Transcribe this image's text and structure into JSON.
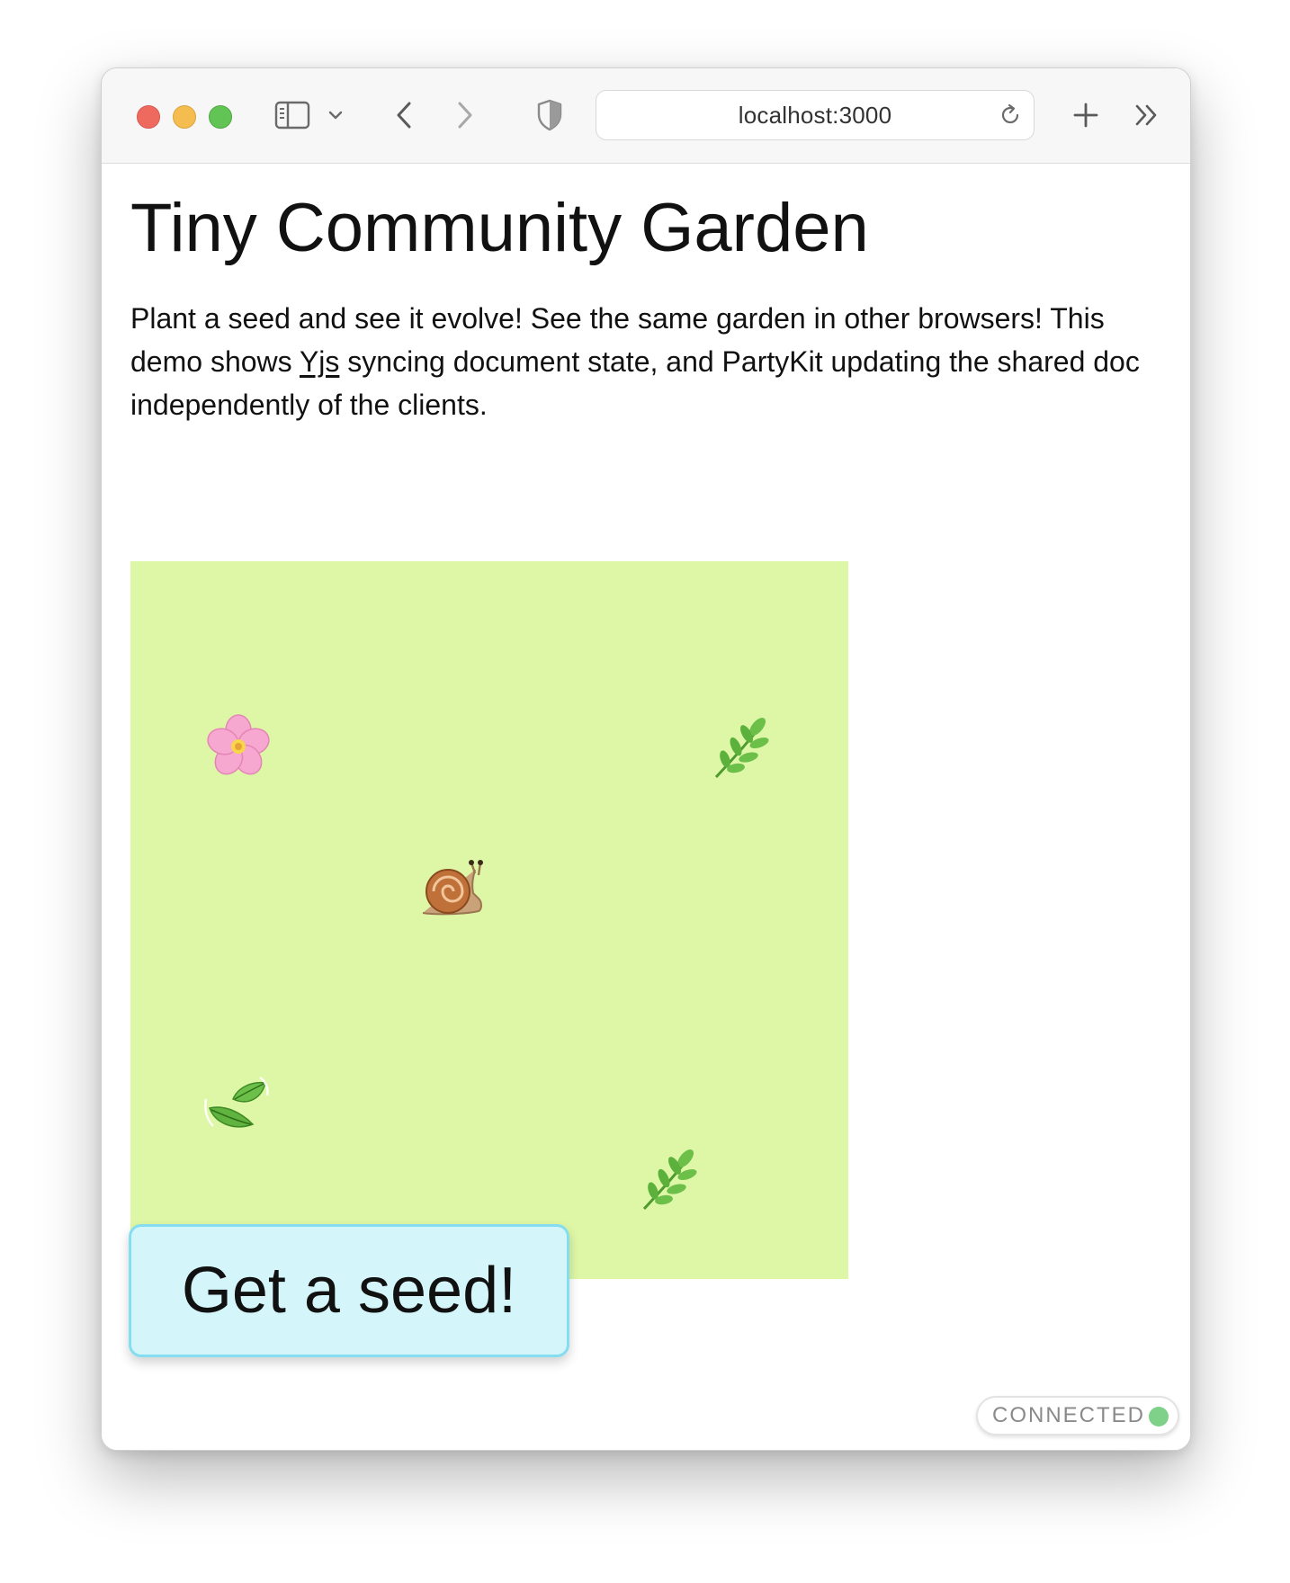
{
  "browser": {
    "url": "localhost:3000",
    "icons": {
      "close": "close-dot",
      "minimize": "minimize-dot",
      "zoom": "zoom-dot",
      "sidebar": "sidebar-icon",
      "tab_menu": "chevron-down-icon",
      "back": "chevron-left-icon",
      "forward": "chevron-right-icon",
      "privacy": "shield-icon",
      "reload": "reload-icon",
      "new_tab": "plus-icon",
      "more": "double-chevron-right-icon"
    }
  },
  "page": {
    "title": "Tiny Community Garden",
    "intro": {
      "part1": "Plant a seed and see it evolve! See the same garden in other browsers! This demo shows ",
      "link": "Yjs",
      "part2": " syncing document state, and PartyKit updating the shared doc independently of the clients."
    }
  },
  "garden": {
    "background": "#def7a6",
    "items": [
      {
        "name": "cherry-blossom",
        "kind": "flower"
      },
      {
        "name": "herb",
        "kind": "sprig"
      },
      {
        "name": "snail",
        "kind": "critter"
      },
      {
        "name": "leaves-in-wind",
        "kind": "leaves"
      },
      {
        "name": "herb",
        "kind": "sprig"
      }
    ]
  },
  "actions": {
    "seed_button_label": "Get a seed!"
  },
  "status": {
    "label": "CONNECTED",
    "color": "#7fd18a"
  },
  "colors": {
    "button_bg": "#d4f6fb",
    "button_border": "#85def0"
  }
}
